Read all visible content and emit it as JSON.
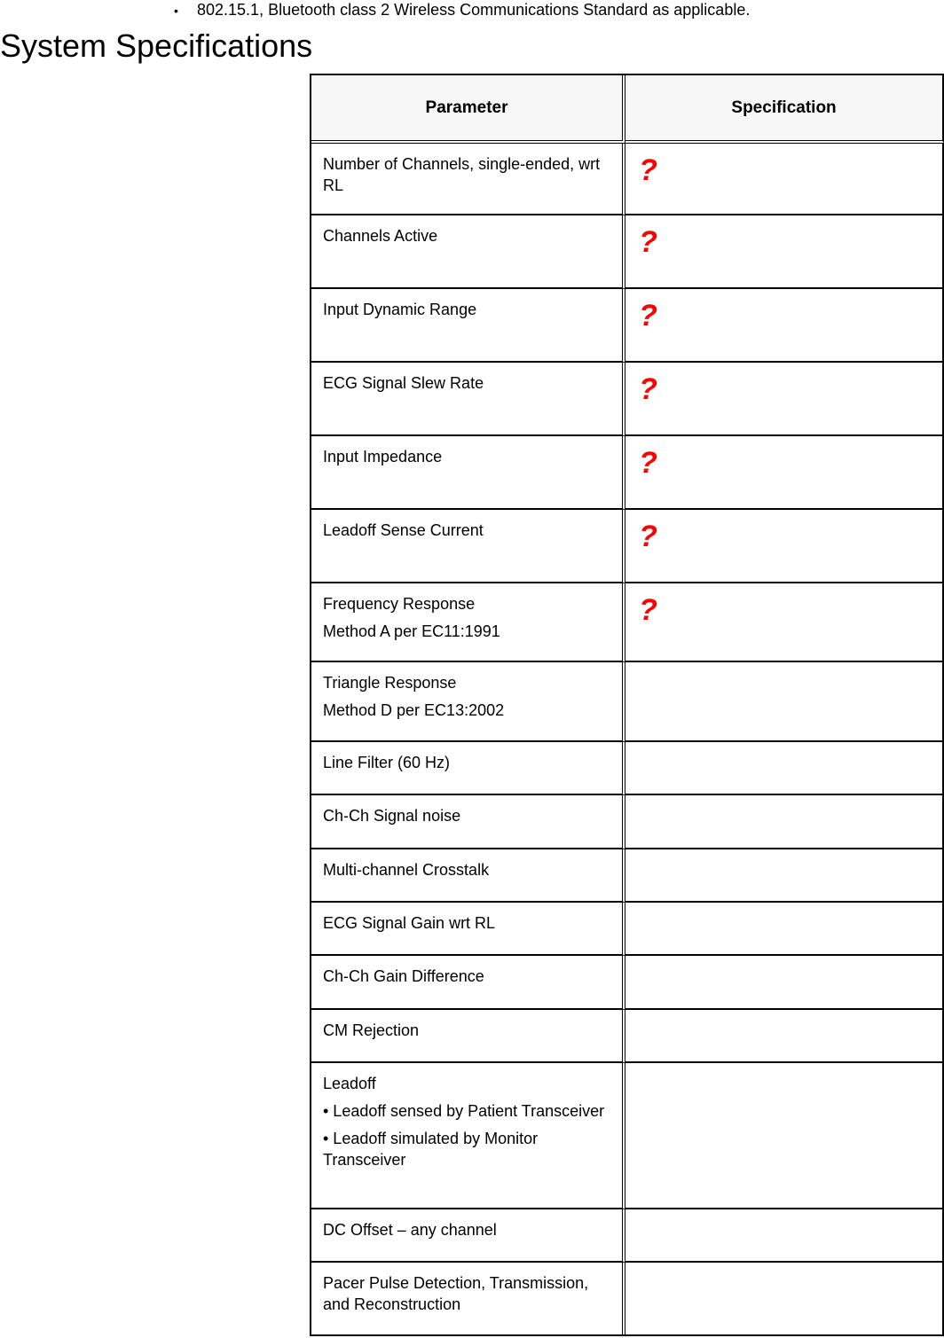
{
  "bullet_item": {
    "marker": "•",
    "text": "802.15.1, Bluetooth class 2 Wireless Communications Standard as applicable."
  },
  "page_title": "System Specifications",
  "table": {
    "headers": {
      "parameter": "Parameter",
      "specification": "Specification"
    },
    "rows": [
      {
        "parameter": [
          "Number of Channels, single-ended, wrt RL"
        ],
        "specification": "?"
      },
      {
        "parameter": [
          "Channels Active"
        ],
        "specification": "?"
      },
      {
        "parameter": [
          "Input Dynamic Range"
        ],
        "specification": "?"
      },
      {
        "parameter": [
          "ECG Signal Slew Rate"
        ],
        "specification": "?"
      },
      {
        "parameter": [
          "Input Impedance"
        ],
        "specification": "?"
      },
      {
        "parameter": [
          "Leadoff Sense Current"
        ],
        "specification": "?"
      },
      {
        "parameter": [
          "Frequency Response",
          "Method A per EC11:1991"
        ],
        "specification": "?"
      },
      {
        "parameter": [
          "Triangle Response",
          "Method D per EC13:2002"
        ],
        "specification": ""
      },
      {
        "parameter": [
          "Line Filter (60 Hz)"
        ],
        "specification": ""
      },
      {
        "parameter": [
          "Ch-Ch Signal noise"
        ],
        "specification": ""
      },
      {
        "parameter": [
          "Multi-channel Crosstalk"
        ],
        "specification": ""
      },
      {
        "parameter": [
          "ECG Signal Gain wrt RL"
        ],
        "specification": ""
      },
      {
        "parameter": [
          "Ch-Ch Gain Difference"
        ],
        "specification": ""
      },
      {
        "parameter": [
          "CM Rejection"
        ],
        "specification": ""
      },
      {
        "parameter": [
          "Leadoff",
          "• Leadoff sensed by Patient Transceiver",
          "• Leadoff simulated by Monitor Transceiver"
        ],
        "specification": ""
      },
      {
        "parameter": [
          "DC Offset – any channel"
        ],
        "specification": ""
      },
      {
        "parameter": [
          "Pacer Pulse Detection, Transmission, and Reconstruction"
        ],
        "specification": ""
      }
    ]
  },
  "colors": {
    "question_mark": "#ff0000",
    "header_background": "#f7f7f7"
  }
}
